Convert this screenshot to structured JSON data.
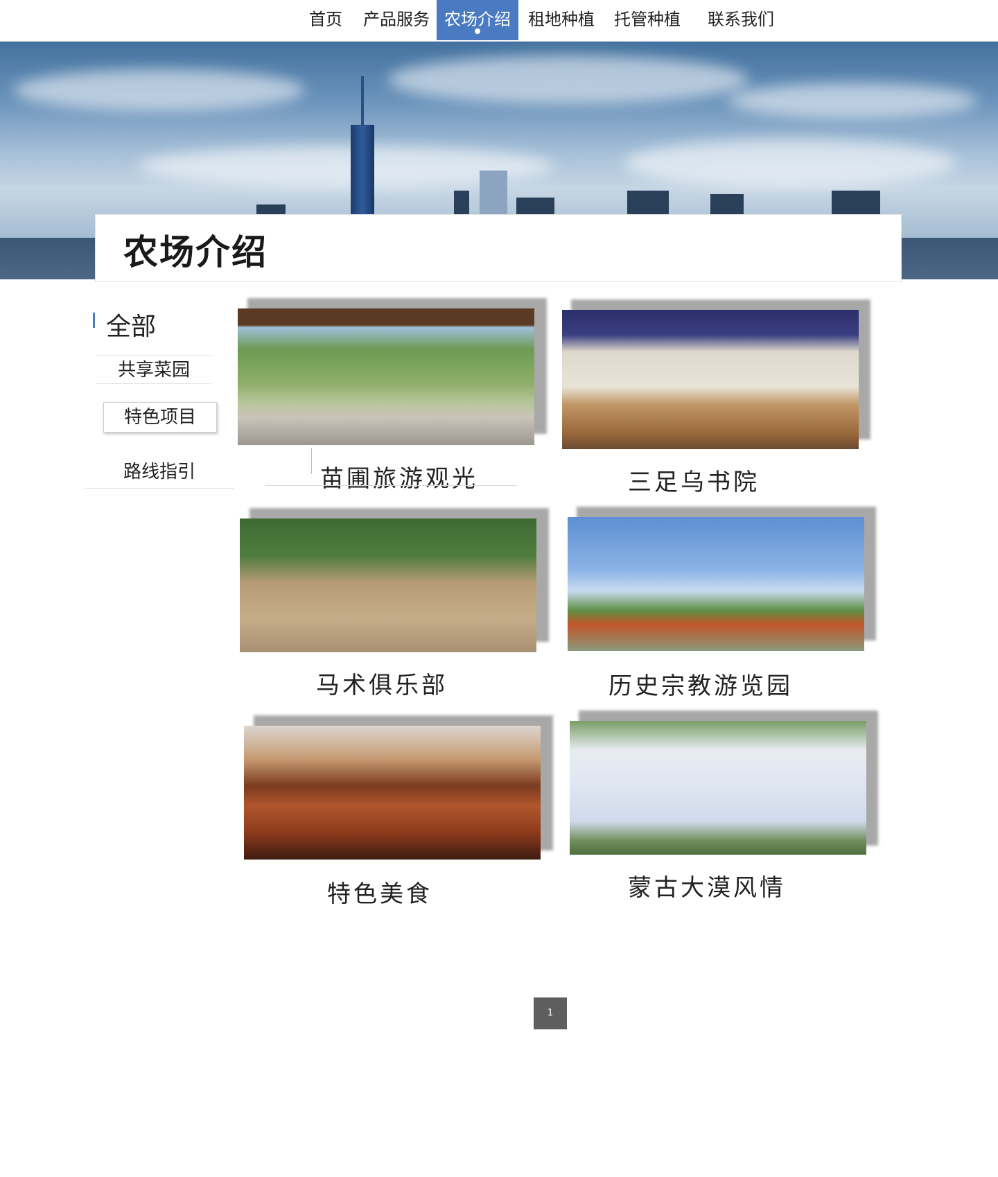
{
  "nav": {
    "items": [
      {
        "label": "首页"
      },
      {
        "label": "产品服务"
      },
      {
        "label": "农场介绍"
      },
      {
        "label": "租地种植"
      },
      {
        "label": "托管种植"
      },
      {
        "label": "联系我们"
      }
    ],
    "active_index": 2
  },
  "page": {
    "title": "农场介绍"
  },
  "sidebar": {
    "all_label": "全部",
    "items": [
      {
        "label": "共享菜园"
      },
      {
        "label": "特色项目"
      },
      {
        "label": "路线指引"
      }
    ]
  },
  "gallery": {
    "items": [
      {
        "caption": "苗圃旅游观光",
        "image": "pavilion-pond-photo"
      },
      {
        "caption": "三足乌书院",
        "image": "library-hall-photo"
      },
      {
        "caption": "马术俱乐部",
        "image": "horse-washing-photo"
      },
      {
        "caption": "历史宗教游览园",
        "image": "temple-tower-photo"
      },
      {
        "caption": "特色美食",
        "image": "bbq-skewers-photo"
      },
      {
        "caption": "蒙古大漠风情",
        "image": "yurt-camp-photo"
      }
    ]
  },
  "pagination": {
    "current": "1"
  },
  "colors": {
    "accent": "#4a7ac2",
    "pager": "#5e5e5e"
  }
}
